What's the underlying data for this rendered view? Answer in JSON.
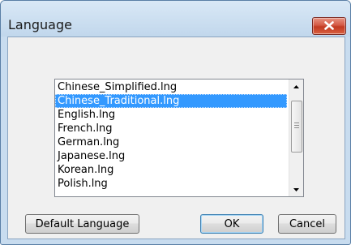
{
  "window": {
    "title": "Language"
  },
  "language_list": {
    "items": [
      "Chinese_Simplified.lng",
      "Chinese_Traditional.lng",
      "English.lng",
      "French.lng",
      "German.lng",
      "Japanese.lng",
      "Korean.lng",
      "Polish.lng"
    ],
    "selected_index": 1
  },
  "buttons": {
    "default_language": "Default Language",
    "ok": "OK",
    "cancel": "Cancel"
  },
  "colors": {
    "selection": "#3399ff",
    "title_bar": "#c8dcef",
    "close_button": "#c94a32"
  }
}
